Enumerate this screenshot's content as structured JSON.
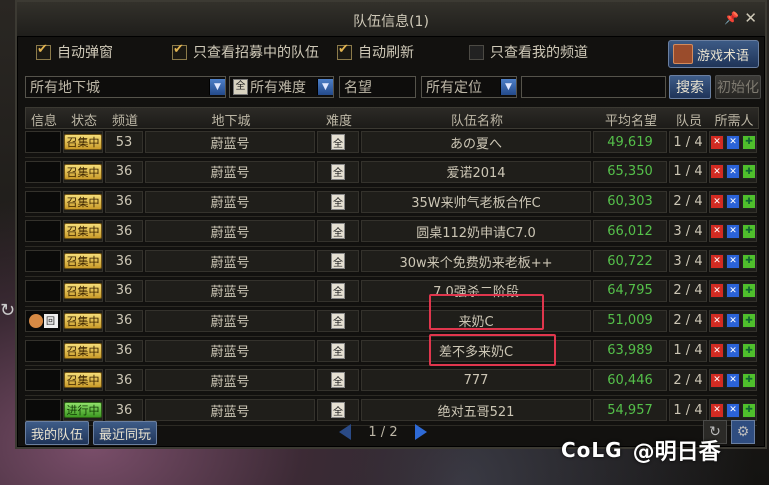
{
  "window": {
    "title": "队伍信息(1)",
    "pin_icon": "pin-icon",
    "close_icon": "close-icon"
  },
  "options": [
    {
      "label": "自动弹窗",
      "checked": true
    },
    {
      "label": "只查看招募中的队伍",
      "checked": true
    },
    {
      "label": "自动刷新",
      "checked": true
    },
    {
      "label": "只查看我的频道",
      "checked": false
    }
  ],
  "game_terms_button": "游戏术语",
  "filters": {
    "dungeon": "所有地下城",
    "difficulty": "所有难度",
    "fame_placeholder": "名望",
    "position": "所有定位",
    "search_value": "",
    "search_button": "搜索",
    "reset_button": "初始化"
  },
  "columns": [
    "信息",
    "状态",
    "频道",
    "地下城",
    "难度",
    "队伍名称",
    "平均名望",
    "队员",
    "所需人员"
  ],
  "rows": [
    {
      "info": "",
      "status": "召集中",
      "status_color": "gold",
      "channel": "53",
      "dungeon": "蔚蓝号",
      "difficulty": "全",
      "team": "あの夏へ",
      "fame": "49,619",
      "members": "1 / 4"
    },
    {
      "info": "",
      "status": "召集中",
      "status_color": "gold",
      "channel": "36",
      "dungeon": "蔚蓝号",
      "difficulty": "全",
      "team": "爱诺2014",
      "fame": "65,350",
      "members": "1 / 4"
    },
    {
      "info": "",
      "status": "召集中",
      "status_color": "gold",
      "channel": "36",
      "dungeon": "蔚蓝号",
      "difficulty": "全",
      "team": "35W来帅气老板合作C",
      "fame": "60,303",
      "members": "2 / 4"
    },
    {
      "info": "",
      "status": "召集中",
      "status_color": "gold",
      "channel": "36",
      "dungeon": "蔚蓝号",
      "difficulty": "全",
      "team": "圆桌112奶申请C7.0",
      "fame": "66,012",
      "members": "3 / 4"
    },
    {
      "info": "",
      "status": "召集中",
      "status_color": "gold",
      "channel": "36",
      "dungeon": "蔚蓝号",
      "difficulty": "全",
      "team": "30w来个免费奶来老板++",
      "fame": "60,722",
      "members": "3 / 4"
    },
    {
      "info": "",
      "status": "召集中",
      "status_color": "gold",
      "channel": "36",
      "dungeon": "蔚蓝号",
      "difficulty": "全",
      "team": "7.0强杀二阶段",
      "fame": "64,795",
      "members": "2 / 4"
    },
    {
      "info": "回",
      "status": "召集中",
      "status_color": "gold",
      "channel": "36",
      "dungeon": "蔚蓝号",
      "difficulty": "全",
      "team": "来奶C",
      "fame": "51,009",
      "members": "2 / 4"
    },
    {
      "info": "",
      "status": "召集中",
      "status_color": "gold",
      "channel": "36",
      "dungeon": "蔚蓝号",
      "difficulty": "全",
      "team": "差不多来奶C",
      "fame": "63,989",
      "members": "1 / 4"
    },
    {
      "info": "",
      "status": "召集中",
      "status_color": "gold",
      "channel": "36",
      "dungeon": "蔚蓝号",
      "difficulty": "全",
      "team": "777",
      "fame": "60,446",
      "members": "2 / 4"
    },
    {
      "info": "",
      "status": "进行中",
      "status_color": "green",
      "channel": "36",
      "dungeon": "蔚蓝号",
      "difficulty": "全",
      "team": "绝对五哥521",
      "fame": "54,957",
      "members": "1 / 4"
    }
  ],
  "bottom": {
    "my_team": "我的队伍",
    "recent": "最近同玩",
    "page": "1 / 2"
  },
  "watermark": {
    "logo": "CoLG",
    "user": "@明日香"
  },
  "colors": {
    "accent_blue": "#2e6ad6",
    "fame_green": "#55c04a",
    "highlight_red": "#e0364d"
  }
}
